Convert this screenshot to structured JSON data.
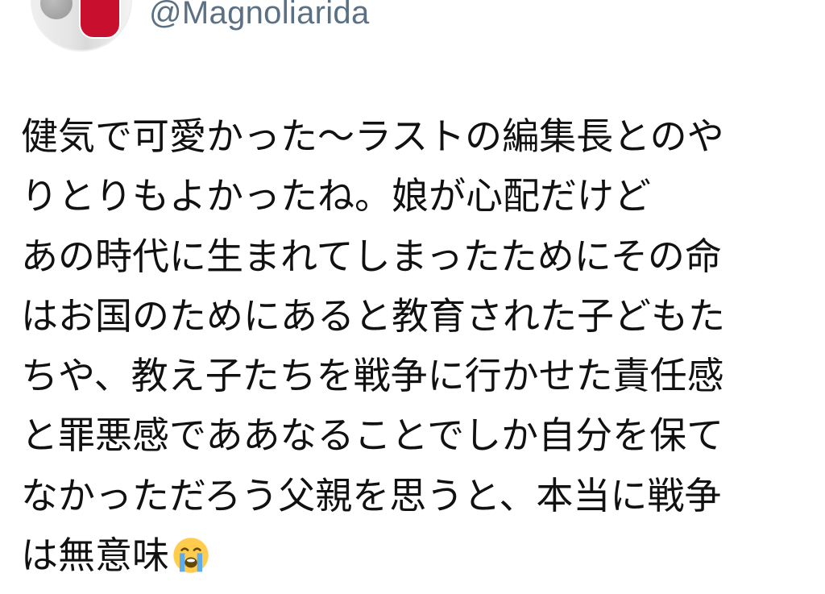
{
  "author": {
    "handle": "@Magnoliarida",
    "avatar_colors": {
      "badge": "#c8102e"
    }
  },
  "tweet": {
    "lines": [
      "健気で可愛かった〜ラストの編集長とのや",
      "りとりもよかったね。娘が心配だけど",
      "あの時代に生まれてしまったためにその命",
      "はお国のためにあると教育された子どもた",
      "ちや、教え子たちを戦争に行かせた責任感",
      "と罪悪感でああなることでしか自分を保て",
      "なかっただろう父親を思うと、本当に戦争",
      "は無意味"
    ],
    "trailing_emoji": "loudly-crying-face-icon"
  },
  "colors": {
    "handle": "#5b7083",
    "text": "#111111",
    "emoji_face": "#ffcc4d",
    "emoji_tears": "#5dadec"
  }
}
